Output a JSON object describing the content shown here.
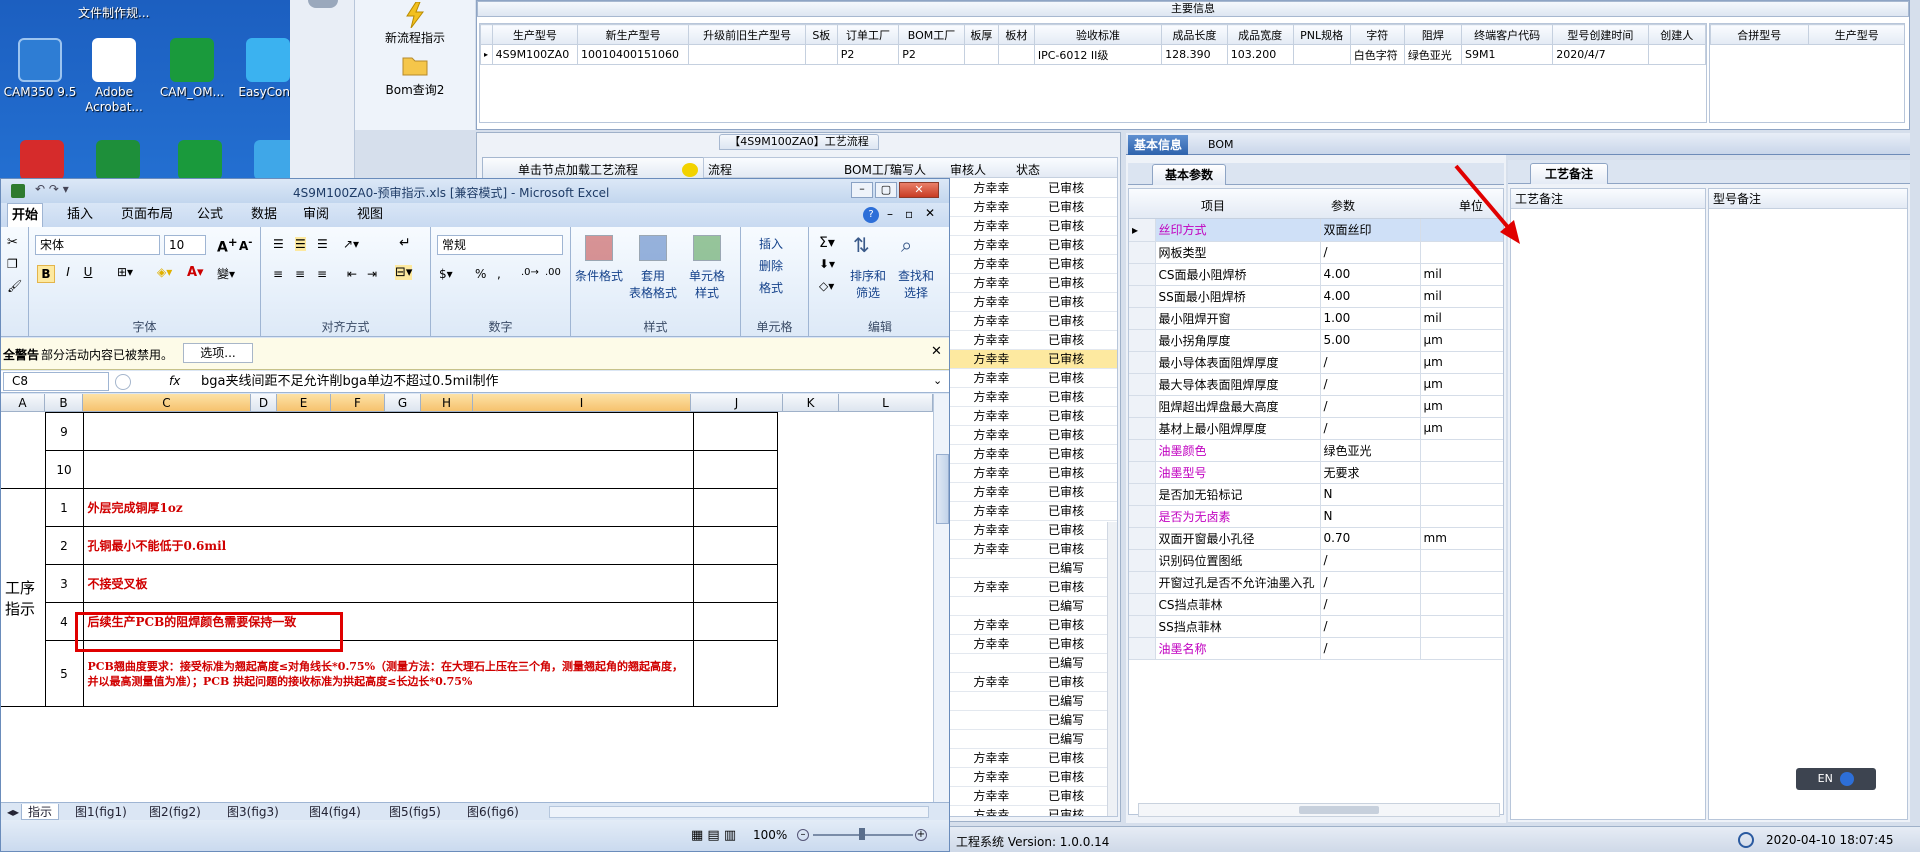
{
  "desktop": {
    "top_text": "文件制作规...",
    "icons": [
      {
        "label": "CAM350 9.5",
        "icon": "cam350-icon"
      },
      {
        "label": "Adobe Acrobat...",
        "icon": "acrobat-icon"
      },
      {
        "label": "CAM_OM...",
        "icon": "cam-om-icon"
      },
      {
        "label": "EasyConn",
        "icon": "easyconn-icon"
      }
    ]
  },
  "toolbar": {
    "new_flow": "新流程指示",
    "bom_query": "Bom查询2"
  },
  "main_info": {
    "title": "主要信息",
    "columns": [
      "生产型号",
      "新生产型号",
      "升级前旧生产型号",
      "S板",
      "订单工厂",
      "BOM工厂",
      "板厚",
      "板材",
      "验收标准",
      "成品长度",
      "成品宽度",
      "PNL规格",
      "字符",
      "阻焊",
      "终端客户代码",
      "型号创建时间",
      "创建人"
    ],
    "row": [
      "4S9M100ZA0",
      "10010400151060",
      "",
      "",
      "P2",
      "P2",
      "",
      "",
      "IPC-6012 II级",
      "128.390",
      "103.200",
      "",
      "白色字符",
      "绿色亚光",
      "S9M1",
      "2020/4/7",
      ""
    ],
    "side_columns": [
      "合拼型号",
      "生产型号"
    ]
  },
  "process": {
    "title": "【4S9M100ZA0】工艺流程",
    "load_btn": "单击节点加载工艺流程",
    "columns": [
      "流程",
      "BOM工厂",
      "编写人",
      "审核人",
      "状态"
    ],
    "rows": [
      {
        "reviewer": "方幸幸",
        "status": "已审核"
      },
      {
        "reviewer": "方幸幸",
        "status": "已审核"
      },
      {
        "reviewer": "方幸幸",
        "status": "已审核"
      },
      {
        "reviewer": "方幸幸",
        "status": "已审核"
      },
      {
        "reviewer": "方幸幸",
        "status": "已审核"
      },
      {
        "reviewer": "方幸幸",
        "status": "已审核"
      },
      {
        "reviewer": "方幸幸",
        "status": "已审核"
      },
      {
        "reviewer": "方幸幸",
        "status": "已审核"
      },
      {
        "reviewer": "方幸幸",
        "status": "已审核"
      },
      {
        "reviewer": "方幸幸",
        "status": "已审核"
      },
      {
        "reviewer": "方幸幸",
        "status": "已审核"
      },
      {
        "reviewer": "方幸幸",
        "status": "已审核"
      },
      {
        "reviewer": "方幸幸",
        "status": "已审核"
      },
      {
        "reviewer": "方幸幸",
        "status": "已审核"
      },
      {
        "reviewer": "方幸幸",
        "status": "已审核"
      },
      {
        "reviewer": "方幸幸",
        "status": "已审核"
      },
      {
        "reviewer": "方幸幸",
        "status": "已审核"
      },
      {
        "reviewer": "方幸幸",
        "status": "已审核"
      },
      {
        "reviewer": "方幸幸",
        "status": "已审核"
      },
      {
        "reviewer": "方幸幸",
        "status": "已审核"
      },
      {
        "reviewer": "",
        "status": "已编写"
      },
      {
        "reviewer": "方幸幸",
        "status": "已审核"
      },
      {
        "reviewer": "",
        "status": "已编写"
      },
      {
        "reviewer": "方幸幸",
        "status": "已审核"
      },
      {
        "reviewer": "方幸幸",
        "status": "已审核"
      },
      {
        "reviewer": "",
        "status": "已编写"
      },
      {
        "reviewer": "方幸幸",
        "status": "已审核"
      },
      {
        "reviewer": "",
        "status": "已编写"
      },
      {
        "reviewer": "",
        "status": "已编写"
      },
      {
        "reviewer": "",
        "status": "已编写"
      },
      {
        "reviewer": "方幸幸",
        "status": "已审核"
      },
      {
        "reviewer": "方幸幸",
        "status": "已审核"
      },
      {
        "reviewer": "方幸幸",
        "status": "已审核"
      },
      {
        "reviewer": "方幸幸",
        "status": "已审核"
      },
      {
        "reviewer": "方幸幸",
        "status": "已审核"
      },
      {
        "reviewer": "方幸幸",
        "status": "已审核"
      }
    ]
  },
  "base_info": {
    "tabs": [
      "基本信息",
      "BOM"
    ],
    "sub_tab": "基本参数",
    "columns": [
      "项目",
      "参数",
      "单位"
    ],
    "rows": [
      {
        "item": "丝印方式",
        "value": "双面丝印",
        "unit": "",
        "color": "#c000c0"
      },
      {
        "item": "网板类型",
        "value": "/",
        "unit": "",
        "color": "#000000"
      },
      {
        "item": "CS面最小阻焊桥",
        "value": "4.00",
        "unit": "mil",
        "color": "#000000"
      },
      {
        "item": "SS面最小阻焊桥",
        "value": "4.00",
        "unit": "mil",
        "color": "#000000"
      },
      {
        "item": "最小阻焊开窗",
        "value": "1.00",
        "unit": "mil",
        "color": "#000000"
      },
      {
        "item": "最小拐角厚度",
        "value": "5.00",
        "unit": "μm",
        "color": "#000000"
      },
      {
        "item": "最小导体表面阻焊厚度",
        "value": "/",
        "unit": "μm",
        "color": "#000000"
      },
      {
        "item": "最大导体表面阻焊厚度",
        "value": "/",
        "unit": "μm",
        "color": "#000000"
      },
      {
        "item": "阻焊超出焊盘最大高度",
        "value": "/",
        "unit": "μm",
        "color": "#000000"
      },
      {
        "item": "基材上最小阻焊厚度",
        "value": "/",
        "unit": "μm",
        "color": "#000000"
      },
      {
        "item": "油墨颜色",
        "value": "绿色亚光",
        "unit": "",
        "color": "#c000c0"
      },
      {
        "item": "油墨型号",
        "value": "无要求",
        "unit": "",
        "color": "#c000c0"
      },
      {
        "item": "是否加无铅标记",
        "value": "N",
        "unit": "",
        "color": "#000000"
      },
      {
        "item": "是否为无卤素",
        "value": "N",
        "unit": "",
        "color": "#c000c0"
      },
      {
        "item": "双面开窗最小孔径",
        "value": "0.70",
        "unit": "mm",
        "color": "#000000"
      },
      {
        "item": "识别码位置图纸",
        "value": "/",
        "unit": "",
        "color": "#000000"
      },
      {
        "item": "开窗过孔是否不允许油墨入孔",
        "value": "/",
        "unit": "",
        "color": "#000000"
      },
      {
        "item": "CS挡点菲林",
        "value": "/",
        "unit": "",
        "color": "#000000"
      },
      {
        "item": "SS挡点菲林",
        "value": "/",
        "unit": "",
        "color": "#000000"
      },
      {
        "item": "油墨名称",
        "value": "/",
        "unit": "",
        "color": "#c000c0"
      }
    ]
  },
  "remarks": {
    "tab": "工艺备注",
    "col1": "工艺备注",
    "col2": "型号备注"
  },
  "status_bar": {
    "system": "工程系统 Version: 1.0.0.14",
    "datetime": "2020-04-10 18:07:45",
    "ime": "EN"
  },
  "excel": {
    "title": "4S9M100ZA0-预审指示.xls [兼容模式] - Microsoft Excel",
    "ribbon_tabs": [
      "开始",
      "插入",
      "页面布局",
      "公式",
      "数据",
      "审阅",
      "视图"
    ],
    "font_name": "宋体",
    "font_size": "10",
    "number_format": "常规",
    "groups": [
      "字体",
      "对齐方式",
      "数字",
      "样式",
      "单元格",
      "编辑"
    ],
    "style_btns": [
      "条件格式",
      "套用\n表格格式",
      "单元格\n样式"
    ],
    "cell_btns": [
      "插入",
      "删除",
      "格式"
    ],
    "edit_btns": [
      "排序和\n筛选",
      "查找和\n选择"
    ],
    "security_label": "全警告",
    "security_text": "部分活动内容已被禁用。",
    "options_btn": "选项...",
    "name_box": "C8",
    "formula": "bga夹线间距不足允许削bga单边不超过0.5mil制作",
    "col_headers": [
      "A",
      "B",
      "C",
      "D",
      "E",
      "F",
      "G",
      "H",
      "I",
      "J",
      "K",
      "L"
    ],
    "section_label": "工序\n指示",
    "rows": [
      {
        "no": "9",
        "text": ""
      },
      {
        "no": "10",
        "text": ""
      },
      {
        "no": "1",
        "text": "外层完成铜厚1oz"
      },
      {
        "no": "2",
        "text": "孔铜最小不能低于0.6mil"
      },
      {
        "no": "3",
        "text": "不接受叉板"
      },
      {
        "no": "4",
        "text": "后续生产PCB的阻焊颜色需要保持一致"
      },
      {
        "no": "5",
        "text": "PCB翘曲度要求：接受标准为翘起高度≤对角线长*0.75%（测量方法：在大理石上压在三个角，测量翘起角的翘起高度，并以最高测量值为准）；PCB 拱起问题的接收标准为拱起高度≤长边长*0.75%"
      }
    ],
    "sheet_tabs": [
      "指示",
      "图1(fig1)",
      "图2(fig2)",
      "图3(fig3)",
      "图4(fig4)",
      "图5(fig5)",
      "图6(fig6)"
    ],
    "zoom": "100%"
  }
}
